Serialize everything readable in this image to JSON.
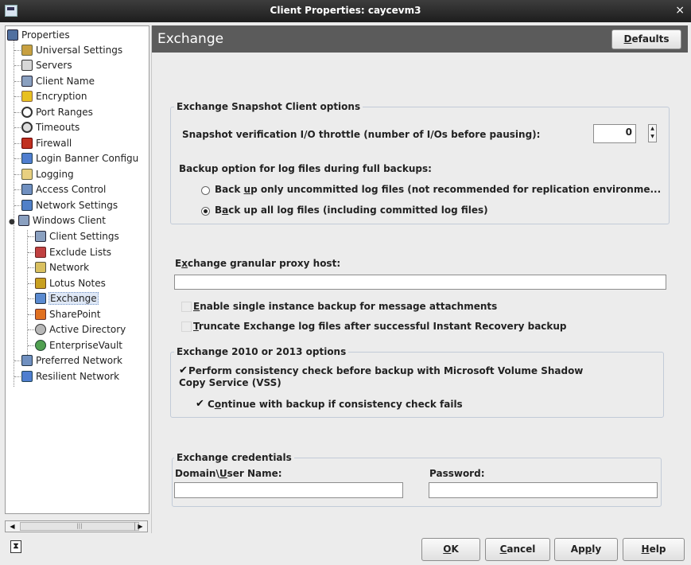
{
  "window": {
    "title": "Client Properties: caycevm3",
    "close_glyph": "×"
  },
  "tree": {
    "root": "Properties",
    "items": [
      {
        "label": "Universal Settings",
        "icon": "universal-settings-icon"
      },
      {
        "label": "Servers",
        "icon": "servers-icon"
      },
      {
        "label": "Client Name",
        "icon": "client-name-icon"
      },
      {
        "label": "Encryption",
        "icon": "lock-icon"
      },
      {
        "label": "Port Ranges",
        "icon": "port-ranges-icon"
      },
      {
        "label": "Timeouts",
        "icon": "clock-icon"
      },
      {
        "label": "Firewall",
        "icon": "firewall-icon"
      },
      {
        "label": "Login Banner Configu",
        "icon": "login-banner-icon"
      },
      {
        "label": "Logging",
        "icon": "logging-icon"
      },
      {
        "label": "Access Control",
        "icon": "access-control-icon"
      },
      {
        "label": "Network Settings",
        "icon": "network-settings-icon"
      },
      {
        "label": "Windows Client",
        "icon": "windows-client-icon"
      }
    ],
    "sub_items": [
      {
        "label": "Client Settings",
        "icon": "client-settings-icon"
      },
      {
        "label": "Exclude Lists",
        "icon": "exclude-lists-icon"
      },
      {
        "label": "Network",
        "icon": "network-icon"
      },
      {
        "label": "Lotus Notes",
        "icon": "lotus-notes-icon"
      },
      {
        "label": "Exchange",
        "icon": "exchange-icon",
        "selected": true
      },
      {
        "label": "SharePoint",
        "icon": "sharepoint-icon"
      },
      {
        "label": "Active Directory",
        "icon": "active-directory-icon"
      },
      {
        "label": "EnterpriseVault",
        "icon": "enterprise-vault-icon"
      }
    ],
    "bottom_items": [
      {
        "label": "Preferred Network",
        "icon": "preferred-network-icon"
      },
      {
        "label": "Resilient Network",
        "icon": "resilient-network-icon"
      }
    ]
  },
  "panel": {
    "title": "Exchange",
    "defaults": {
      "mn": "D",
      "rest": "efaults"
    },
    "snapshot_group": {
      "title": "Exchange Snapshot Client options",
      "throttle_label": "Snapshot verification I/O throttle (number of I/Os before pausing):",
      "throttle_value": "0",
      "backup_option_label": "Backup option for log files during full backups:",
      "radio1": {
        "pre": "Back ",
        "mn": "u",
        "post": "p only uncommitted log files (not recommended for replication environme...",
        "selected": false
      },
      "radio2": {
        "pre": "B",
        "mn": "a",
        "post": "ck up all log files (including committed log files)",
        "selected": true
      }
    },
    "proxy": {
      "pre": "E",
      "mn": "x",
      "post": "change granular proxy host:",
      "value": ""
    },
    "single_instance": {
      "mn": "E",
      "post": "nable single instance backup for message attachments",
      "checked": false
    },
    "truncate": {
      "mn": "T",
      "post": "runcate Exchange log files after successful Instant Recovery backup",
      "checked": false
    },
    "ex2010_group": {
      "title": "Exchange 2010 or 2013 options",
      "consistency_line1": "Perform consistency check before backup with Microsoft Volume Shadow",
      "consistency_line2": "Copy Service (VSS)",
      "continue": {
        "pre": "C",
        "mn": "o",
        "post": "ntinue with backup if consistency check fails"
      },
      "consistency_checked": true,
      "continue_checked": true
    },
    "credentials": {
      "title": "Exchange credentials",
      "domain_pre": "Domain\\",
      "domain_mn": "U",
      "domain_post": "ser Name:",
      "password_label": "Password:",
      "domain_value": "",
      "password_value": ""
    }
  },
  "buttons": {
    "ok": {
      "mn": "O",
      "post": "K"
    },
    "cancel": {
      "mn": "C",
      "post": "ancel"
    },
    "apply": {
      "pre": "Ap",
      "mn": "p",
      "post": "ly"
    },
    "help": {
      "mn": "H",
      "post": "elp"
    }
  },
  "tick_glyph": "✔",
  "status_icon_glyph": "⧗"
}
